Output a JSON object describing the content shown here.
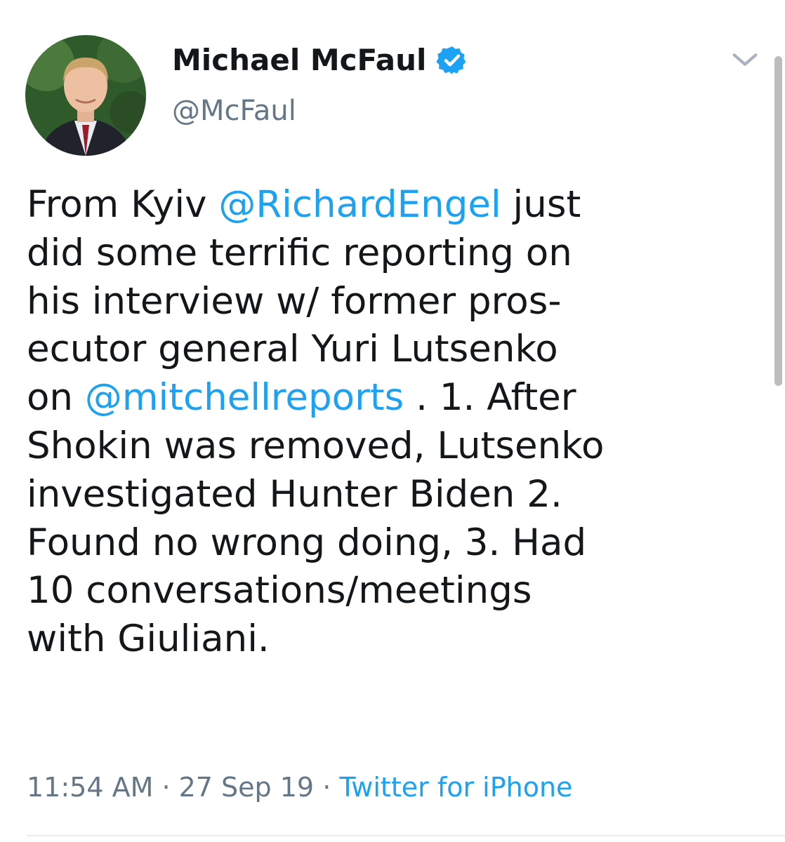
{
  "author": {
    "name": "Michael McFaul",
    "handle": "@McFaul",
    "verified": true
  },
  "tweet": {
    "lines": [
      [
        {
          "t": "From Kyiv ",
          "m": false
        },
        {
          "t": "@RichardEngel",
          "m": true
        },
        {
          "t": " just",
          "m": false
        }
      ],
      [
        {
          "t": "did some terrific reporting on",
          "m": false
        }
      ],
      [
        {
          "t": "his interview w/ former pros-",
          "m": false
        }
      ],
      [
        {
          "t": "ecutor general Yuri Lutsenko",
          "m": false
        }
      ],
      [
        {
          "t": "on ",
          "m": false
        },
        {
          "t": "@mitchellreports",
          "m": true
        },
        {
          "t": " . 1. After",
          "m": false
        }
      ],
      [
        {
          "t": "Shokin was removed, Lutsenko",
          "m": false
        }
      ],
      [
        {
          "t": "investigated Hunter Biden 2.",
          "m": false
        }
      ],
      [
        {
          "t": "Found no wrong doing, 3. Had",
          "m": false
        }
      ],
      [
        {
          "t": "10 conversations/meetings",
          "m": false
        }
      ],
      [
        {
          "t": "with Giuliani.",
          "m": false
        }
      ]
    ]
  },
  "meta": {
    "time": "11:54 AM",
    "sep1": " · ",
    "date": "27 Sep 19",
    "sep2": " · ",
    "source": "Twitter for iPhone"
  },
  "colors": {
    "link": "#1da1f2",
    "text": "#14171a",
    "muted": "#657786",
    "verified_badge": "#1da1f2"
  },
  "icons": {
    "verified": "verified-badge-icon",
    "menu": "chevron-down-icon"
  }
}
